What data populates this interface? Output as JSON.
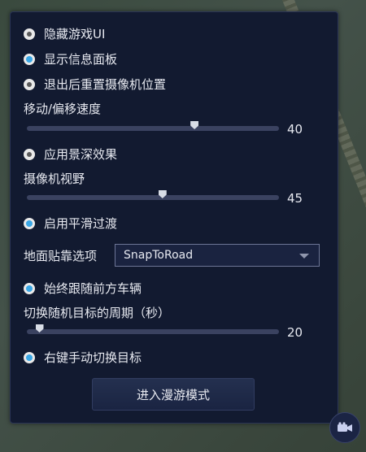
{
  "options": {
    "hide_ui": "隐藏游戏UI",
    "show_info_panel": "显示信息面板",
    "reset_camera": "退出后重置摄像机位置",
    "depth_of_field": "应用景深效果",
    "smooth_transition": "启用平滑过渡",
    "follow_vehicle": "始终跟随前方车辆",
    "right_click_switch": "右键手动切换目标"
  },
  "sliders": {
    "move_speed": {
      "label": "移动/偏移速度",
      "value": "40",
      "fraction": 0.665
    },
    "fov": {
      "label": "摄像机视野",
      "value": "45",
      "fraction": 0.538
    },
    "switch_period": {
      "label": "切换随机目标的周期（秒）",
      "value": "20",
      "fraction": 0.05
    }
  },
  "ground_snap": {
    "label": "地面贴靠选项",
    "selected": "SnapToRoad"
  },
  "enter_button": "进入漫游模式",
  "icons": {
    "camera": "video-camera-icon"
  }
}
